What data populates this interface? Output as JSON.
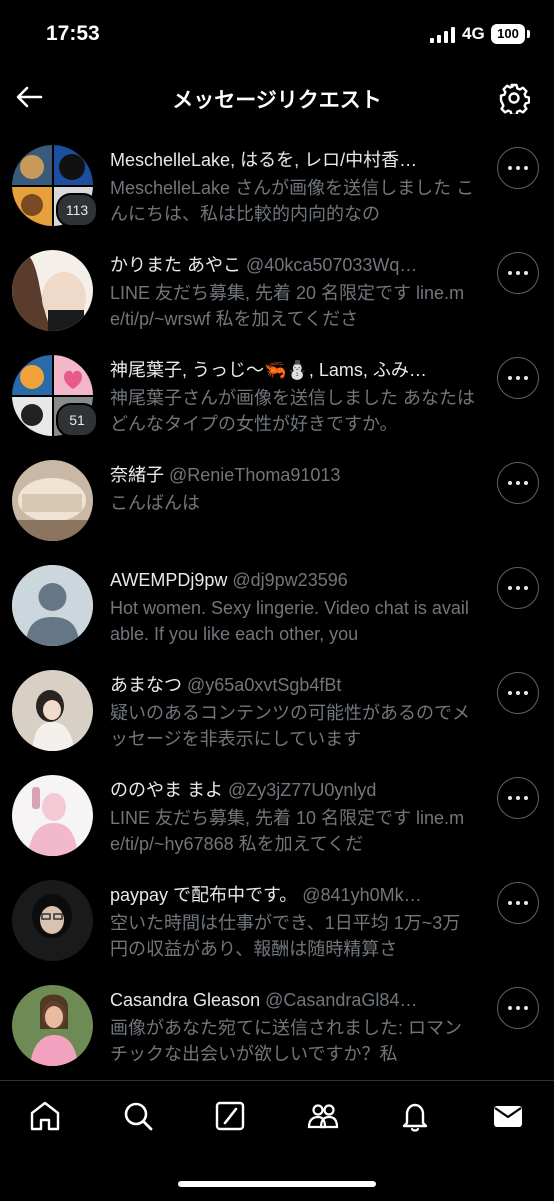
{
  "status": {
    "time": "17:53",
    "network": "4G",
    "battery": "100"
  },
  "header": {
    "title": "メッセージリクエスト"
  },
  "rows": [
    {
      "name": "MeschelleLake, はるを, レロ/中村香…",
      "handle": "",
      "preview": "MeschelleLake さんが画像を送信しました こんにちは、私は比較的内向的なの",
      "badge": "113"
    },
    {
      "name": "かりまた あやこ",
      "handle": "@40kca507033Wq…",
      "preview": "LINE 友だち募集, 先着 20 名限定です line.me/ti/p/~wrswf 私を加えてくださ",
      "badge": ""
    },
    {
      "name": "神尾葉子, うっじ〜🦐⛄, Lams, ふみ…",
      "handle": "",
      "preview": "神尾葉子さんが画像を送信しました あなたはどんなタイプの女性が好きですか。",
      "badge": "51"
    },
    {
      "name": "奈緒子",
      "handle": "@RenieThoma91013",
      "preview": "こんばんは",
      "badge": ""
    },
    {
      "name": "AWEMPDj9pw",
      "handle": "@dj9pw23596",
      "preview": "Hot women. Sexy lingerie. Video chat is available. If you like each other, you",
      "badge": ""
    },
    {
      "name": "あまなつ",
      "handle": "@y65a0xvtSgb4fBt",
      "preview": "疑いのあるコンテンツの可能性があるのでメッセージを非表示にしています",
      "badge": ""
    },
    {
      "name": "ののやま まよ",
      "handle": "@Zy3jZ77U0ynlyd",
      "preview": "LINE 友だち募集, 先着 10 名限定です line.me/ti/p/~hy67868 私を加えてくだ",
      "badge": ""
    },
    {
      "name": "paypay で配布中です。",
      "handle": "@841yh0Mk…",
      "preview": "空いた時間は仕事ができ、1日平均 1万~3万円の収益があり、報酬は随時精算さ",
      "badge": ""
    },
    {
      "name": "Casandra Gleason",
      "handle": "@CasandraGl84…",
      "preview": "画像があなた宛てに送信されました: ロマンチックな出会いが欲しいですか？私",
      "badge": ""
    }
  ],
  "nav": [
    "home-icon",
    "search-icon",
    "grok-icon",
    "communities-icon",
    "notifications-icon",
    "messages-icon"
  ],
  "colors": {
    "background": "#000000",
    "primary_text": "#e7e9ea",
    "secondary_text": "#71767b",
    "border": "#2f3336"
  }
}
